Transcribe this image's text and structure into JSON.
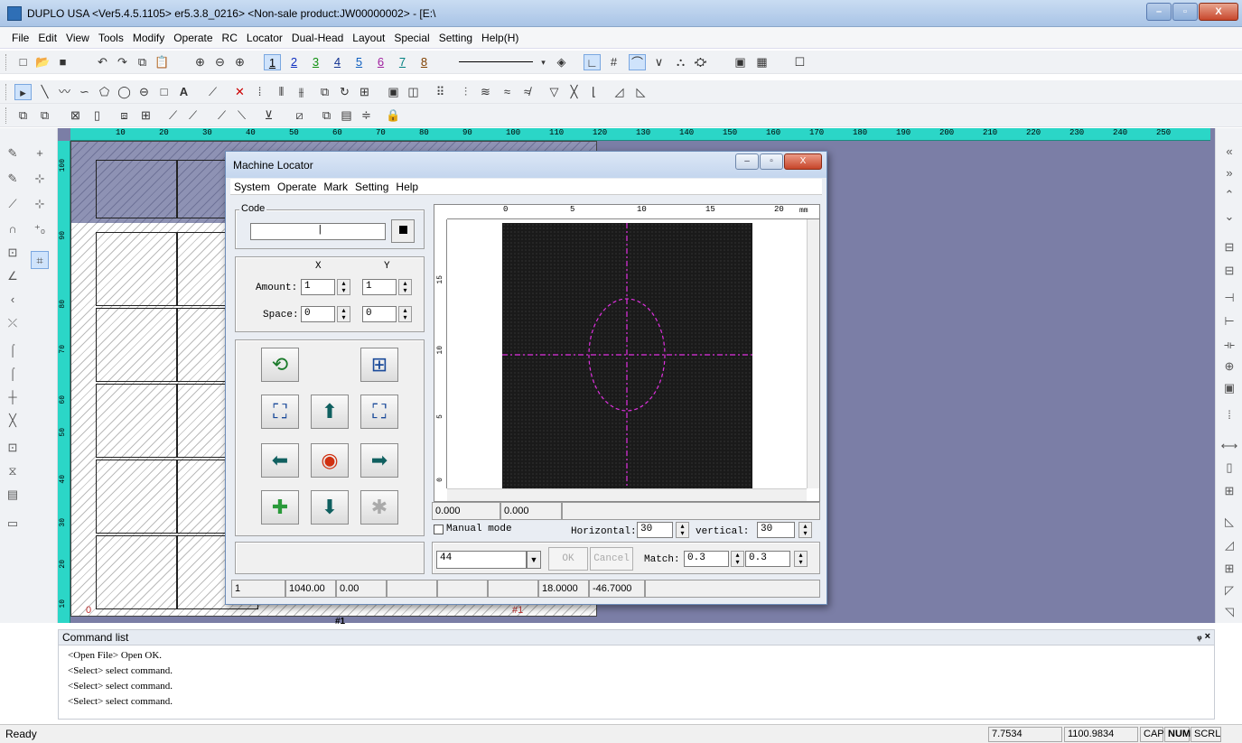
{
  "app": {
    "title": "DUPLO USA <Ver5.4.5.1105> er5.3.8_0216> <Non-sale product:JW00000002> - [E:\\"
  },
  "window_buttons": [
    "–",
    "▫",
    "X"
  ],
  "menu": [
    "File",
    "Edit",
    "View",
    "Tools",
    "Modify",
    "Operate",
    "RC",
    "Locator",
    "Dual-Head",
    "Layout",
    "Special",
    "Setting",
    "Help(H)"
  ],
  "toolbar": {
    "layers": [
      "1",
      "2",
      "3",
      "4",
      "5",
      "6",
      "7",
      "8"
    ]
  },
  "ruler": {
    "top": [
      "10",
      "20",
      "30",
      "40",
      "50",
      "60",
      "70",
      "80",
      "90",
      "100",
      "110",
      "120",
      "130",
      "140",
      "150",
      "160",
      "170",
      "180",
      "190",
      "200",
      "210",
      "220",
      "230",
      "240",
      "250"
    ],
    "left": [
      "100",
      "90",
      "80",
      "70",
      "60",
      "50",
      "40",
      "30",
      "20",
      "10"
    ]
  },
  "sheet": {
    "label_origin": "0",
    "label_bottom": "#1",
    "label_right": "#1"
  },
  "machine_locator": {
    "title": "Machine Locator",
    "menu": [
      "System",
      "Operate",
      "Mark",
      "Setting",
      "Help"
    ],
    "code_label": "Code",
    "col_x": "X",
    "col_y": "Y",
    "amount_label": "Amount:",
    "amount_x": "1",
    "amount_y": "1",
    "space_label": "Space:",
    "space_x": "0",
    "space_y": "0",
    "camera_ruler": [
      "0",
      "5",
      "10",
      "15",
      "20",
      "mm"
    ],
    "camera_vruler": [
      "15",
      "10",
      "5",
      "0"
    ],
    "readout_x": "0.000",
    "readout_y": "0.000",
    "manual_mode": "Manual mode",
    "horizontal_label": "Horizontal:",
    "horizontal_value": "30",
    "vertical_label": "vertical:",
    "vertical_value": "30",
    "select_value": "44",
    "ok": "OK",
    "cancel": "Cancel",
    "match_label": "Match:",
    "match_a": "0.3",
    "match_b": "0.3",
    "status": [
      "1",
      "1040.00",
      "0.00",
      "",
      "",
      "",
      "18.0000",
      "-46.7000"
    ]
  },
  "command_list": {
    "title": "Command list",
    "pin": "ᵩ ×",
    "lines": [
      "<Open File> Open OK.",
      "<Select> select command.",
      "<Select> select command.",
      "<Select> select command."
    ]
  },
  "statusbar": {
    "left": "Ready",
    "x": "7.7534",
    "y": "1100.9834",
    "cap": "CAP",
    "num": "NUM",
    "scrl": "SCRL"
  },
  "colors": {
    "ruler": "#2bd6c7",
    "canvas": "#7b7ea6",
    "crosshair": "#e030e0"
  }
}
